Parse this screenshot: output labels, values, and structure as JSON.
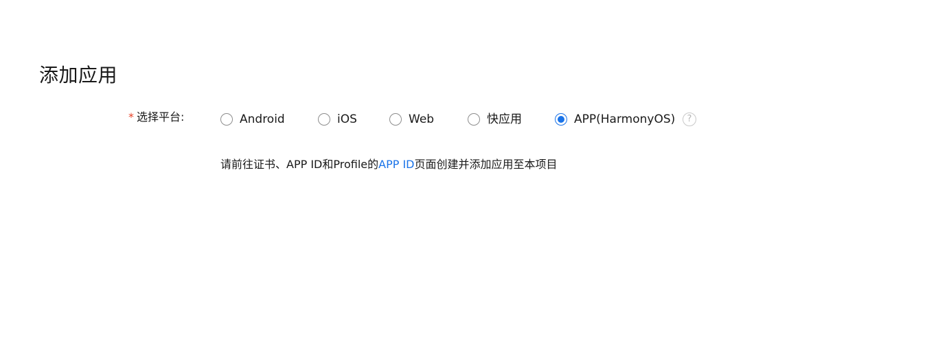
{
  "page": {
    "title": "添加应用"
  },
  "form": {
    "platform_label": "选择平台:",
    "required_mark": "*",
    "options": [
      {
        "label": "Android",
        "selected": false
      },
      {
        "label": "iOS",
        "selected": false
      },
      {
        "label": "Web",
        "selected": false
      },
      {
        "label": "快应用",
        "selected": false
      },
      {
        "label": "APP(HarmonyOS)",
        "selected": true
      }
    ],
    "help_icon": "question-circle-icon",
    "help_symbol": "?"
  },
  "hint": {
    "prefix": "请前往证书、APP ID和Profile的",
    "link_text": "APP ID",
    "suffix": "页面创建并添加应用至本项目"
  },
  "colors": {
    "accent": "#1a73e8",
    "required": "#e84026",
    "text": "#191919",
    "radio_border": "#8c8c8c"
  }
}
